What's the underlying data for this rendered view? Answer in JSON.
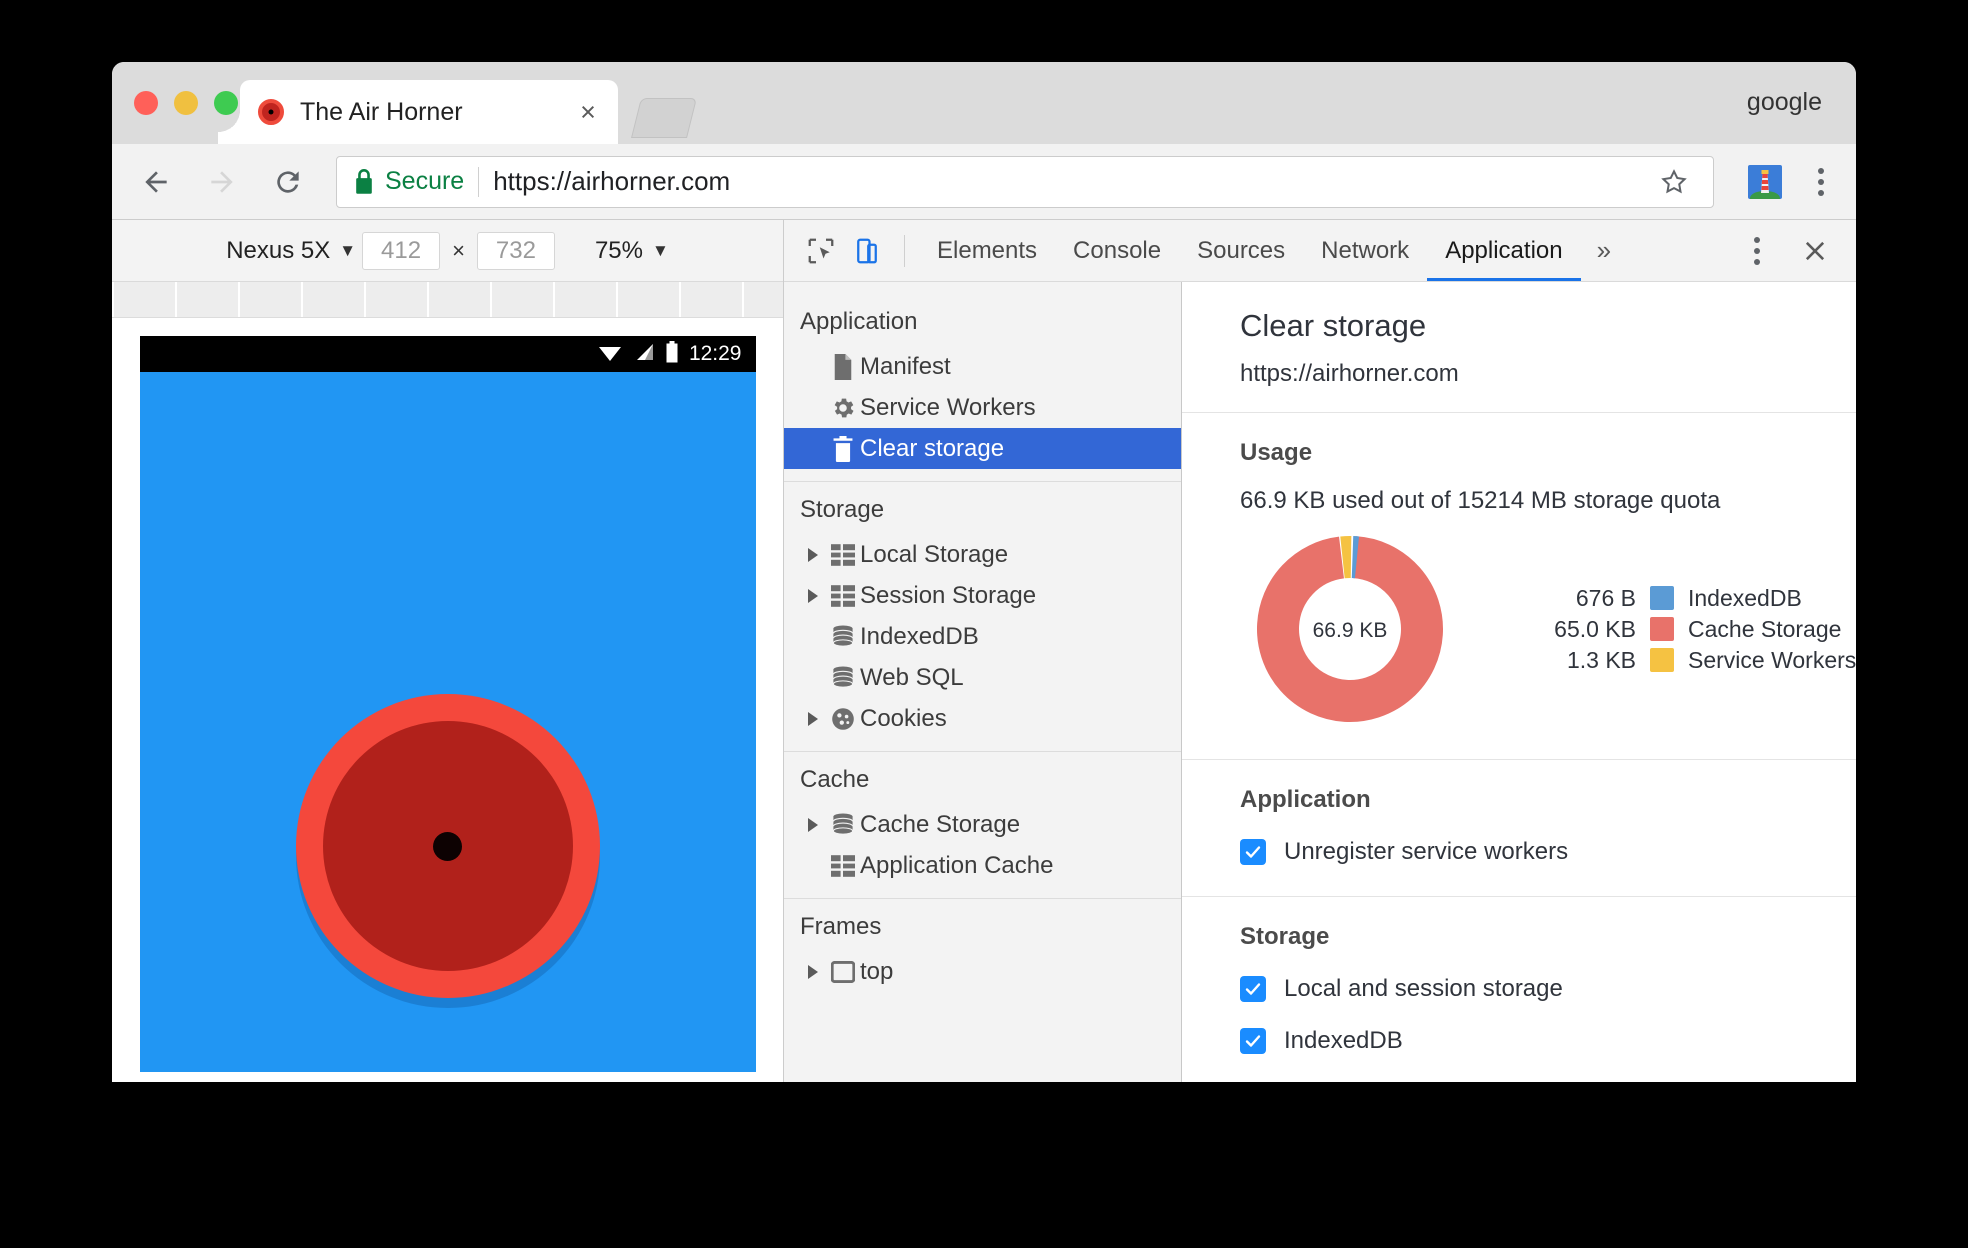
{
  "window": {
    "traffic_lights": [
      "close",
      "minimize",
      "maximize"
    ],
    "profile_label": "google"
  },
  "tab": {
    "title": "The Air Horner",
    "favicon": "airhorn-icon",
    "close_label": "×",
    "new_tab_label": "+"
  },
  "navbar": {
    "back_icon": "back-arrow-icon",
    "forward_icon": "forward-arrow-icon",
    "reload_icon": "reload-icon",
    "security_label": "Secure",
    "url": "https://airhorner.com",
    "star_icon": "bookmark-star-icon",
    "extension_icon": "lighthouse-extension-icon",
    "menu_icon": "three-dot-menu-icon"
  },
  "device_toolbar": {
    "device_name": "Nexus 5X",
    "width": "412",
    "height": "732",
    "zoom": "75%",
    "multiply_symbol": "×",
    "caret": "▼"
  },
  "phone": {
    "status_bar": {
      "wifi_icon": "wifi-icon",
      "signal_icon": "cell-signal-icon",
      "battery_icon": "battery-icon",
      "time": "12:29"
    },
    "app": {
      "name": "airhorn-button",
      "background_color": "#2196f3",
      "outer_color": "#f4483c",
      "inner_color": "#b1211b"
    }
  },
  "devtools": {
    "inspect_icon": "inspect-cursor-icon",
    "device_toggle_icon": "device-toolbar-icon",
    "tabs": [
      {
        "label": "Elements",
        "active": false
      },
      {
        "label": "Console",
        "active": false
      },
      {
        "label": "Sources",
        "active": false
      },
      {
        "label": "Network",
        "active": false
      },
      {
        "label": "Application",
        "active": true
      }
    ],
    "more_tabs": "»",
    "menu_icon": "three-dot-menu-icon",
    "close_icon": "close-icon",
    "accent_color": "#1a73e8"
  },
  "sidebar": {
    "sections": [
      {
        "title": "Application",
        "items": [
          {
            "label": "Manifest",
            "icon": "document-icon",
            "expandable": false,
            "selected": false
          },
          {
            "label": "Service Workers",
            "icon": "gear-icon",
            "expandable": false,
            "selected": false
          },
          {
            "label": "Clear storage",
            "icon": "trash-icon",
            "expandable": false,
            "selected": true
          }
        ]
      },
      {
        "title": "Storage",
        "items": [
          {
            "label": "Local Storage",
            "icon": "table-icon",
            "expandable": true,
            "selected": false
          },
          {
            "label": "Session Storage",
            "icon": "table-icon",
            "expandable": true,
            "selected": false
          },
          {
            "label": "IndexedDB",
            "icon": "database-icon",
            "expandable": false,
            "selected": false
          },
          {
            "label": "Web SQL",
            "icon": "database-icon",
            "expandable": false,
            "selected": false
          },
          {
            "label": "Cookies",
            "icon": "cookie-icon",
            "expandable": true,
            "selected": false
          }
        ]
      },
      {
        "title": "Cache",
        "items": [
          {
            "label": "Cache Storage",
            "icon": "database-icon",
            "expandable": true,
            "selected": false
          },
          {
            "label": "Application Cache",
            "icon": "table-icon",
            "expandable": false,
            "selected": false
          }
        ]
      },
      {
        "title": "Frames",
        "items": [
          {
            "label": "top",
            "icon": "frame-icon",
            "expandable": true,
            "selected": false
          }
        ]
      }
    ]
  },
  "main": {
    "title": "Clear storage",
    "origin": "https://airhorner.com",
    "usage": {
      "heading": "Usage",
      "summary": "66.9 KB used out of 15214 MB storage quota",
      "center_label": "66.9 KB"
    },
    "application_section": {
      "heading": "Application",
      "checkboxes": [
        {
          "label": "Unregister service workers",
          "checked": true
        }
      ]
    },
    "storage_section": {
      "heading": "Storage",
      "checkboxes": [
        {
          "label": "Local and session storage",
          "checked": true
        },
        {
          "label": "IndexedDB",
          "checked": true
        }
      ]
    }
  },
  "chart_data": {
    "type": "pie",
    "title": "Usage",
    "center_label": "66.9 KB",
    "total": "66.9 KB",
    "legend_position": "right",
    "labels": [
      "IndexedDB",
      "Cache Storage",
      "Service Workers"
    ],
    "display_values": [
      "676 B",
      "65.0 KB",
      "1.3 KB"
    ],
    "values": [
      0.676,
      65.0,
      1.3
    ],
    "unit": "KB",
    "percentages": [
      1.0,
      97.1,
      1.9
    ],
    "colors": [
      "#5b9bd5",
      "#e8726a",
      "#f5c242"
    ]
  }
}
